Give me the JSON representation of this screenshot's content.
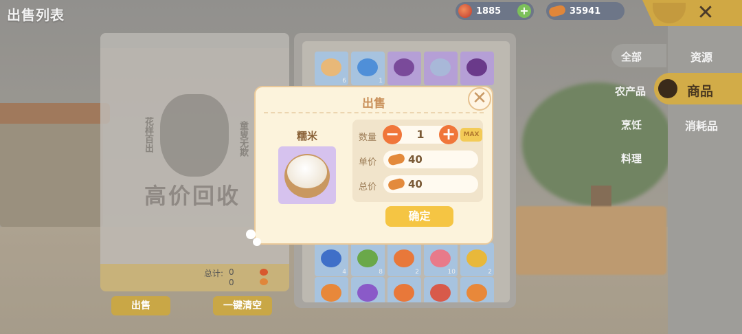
{
  "header": {
    "title": "出售列表"
  },
  "currencies": [
    {
      "name": "gem",
      "value": "1885",
      "plus": "+"
    },
    {
      "name": "gold",
      "value": "35941"
    }
  ],
  "close_label": "✕",
  "main_tabs": [
    {
      "label": "资源",
      "active": false
    },
    {
      "label": "商品",
      "active": true
    },
    {
      "label": "消耗品",
      "active": false
    }
  ],
  "sub_categories": [
    "全部",
    "农产品",
    "烹饪",
    "料理"
  ],
  "sell_list": {
    "watermark": "高价回收",
    "side_left": "花样百出",
    "side_right": "童叟无欺",
    "total_label": "总计:",
    "total_values": [
      "0",
      "0"
    ],
    "sell_button": "出售",
    "clear_button": "一键清空"
  },
  "inventory": {
    "rows": [
      [
        {
          "item": "cake",
          "count": "6",
          "color": "#e8b878"
        },
        {
          "item": "blue-fish",
          "count": "1",
          "color": "#4f8fd8"
        },
        {
          "item": "grape",
          "count": "",
          "color": "#7a4a9a"
        },
        {
          "item": "fish-fillet",
          "count": "",
          "color": "#a8b8d8"
        },
        {
          "item": "eggplant",
          "count": "",
          "color": "#6a3a8a"
        }
      ],
      [
        {
          "item": "blue-fish",
          "count": "4",
          "color": "#3f6fc8"
        },
        {
          "item": "green-frog",
          "count": "8",
          "color": "#6aa84a"
        },
        {
          "item": "orange-fish",
          "count": "2",
          "color": "#e8783a"
        },
        {
          "item": "pink-fish",
          "count": "10",
          "color": "#e87a8a"
        },
        {
          "item": "yellow-fish",
          "count": "2",
          "color": "#e8b83a"
        }
      ],
      [
        {
          "item": "orange-fish",
          "count": "",
          "color": "#e8883a"
        },
        {
          "item": "purple-fish",
          "count": "",
          "color": "#8a5ac8"
        },
        {
          "item": "orange-fish",
          "count": "",
          "color": "#e8783a"
        },
        {
          "item": "red-fish",
          "count": "",
          "color": "#d85a4a"
        },
        {
          "item": "orange-fish",
          "count": "",
          "color": "#e8883a"
        }
      ]
    ]
  },
  "dialog": {
    "title": "出售",
    "close": "✕",
    "item_name": "糯米",
    "quantity_label": "数量",
    "quantity": "1",
    "minus": "−",
    "plus": "+",
    "max_label": "MAX",
    "unit_price_label": "单价",
    "unit_price": "40",
    "total_price_label": "总价",
    "total_price": "40",
    "confirm": "确定"
  }
}
